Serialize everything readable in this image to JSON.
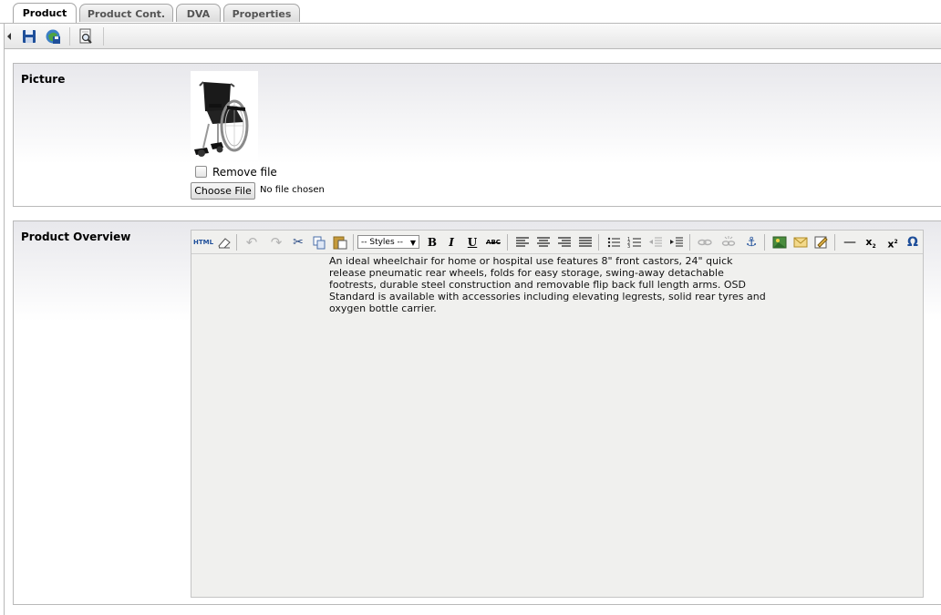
{
  "tabs": [
    {
      "label": "Product",
      "active": true
    },
    {
      "label": "Product Cont."
    },
    {
      "label": "DVA"
    },
    {
      "label": "Properties"
    }
  ],
  "toolbar": {
    "icons": [
      "collapse-arrow-icon",
      "save-icon",
      "save-close-icon",
      "preview-icon"
    ]
  },
  "picture": {
    "label": "Picture",
    "image_alt": "wheelchair",
    "remove_label": "Remove file",
    "choose_button": "Choose File",
    "no_file": "No file chosen"
  },
  "overview": {
    "label": "Product Overview",
    "html_button": "HTML",
    "styles_value": "-- Styles --",
    "lines": [
      "An ideal wheelchair for home or hospital use features 8\" front castors, 24\" quick",
      "release pneumatic rear wheels, folds for easy storage, swing-away detachable",
      "footrests, durable steel construction and removable flip back full length arms. OSD",
      "Standard is available with accessories including elevating legrests, solid rear tyres and",
      "oxygen bottle carrier."
    ]
  },
  "colors": {
    "accent": "#1f4f9a",
    "border": "#b9b9b9"
  }
}
